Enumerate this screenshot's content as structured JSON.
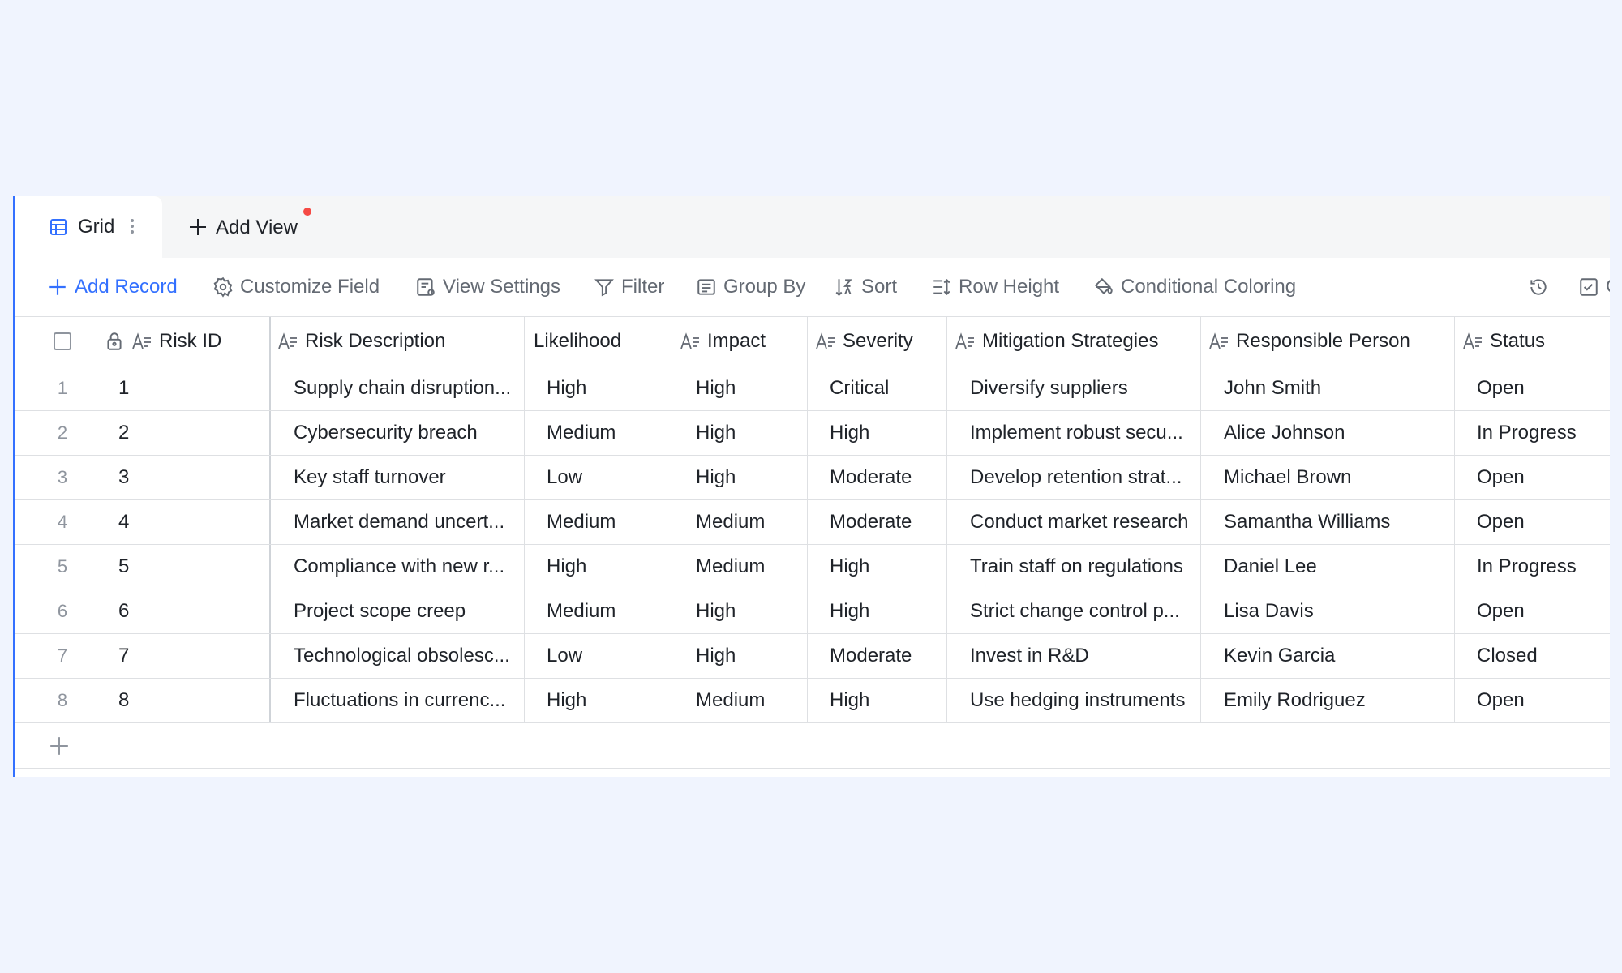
{
  "colors": {
    "accent": "#3370ff",
    "notice_dot": "#f54a45",
    "muted": "#646a73",
    "border": "#dee0e3"
  },
  "tabs": {
    "active": {
      "label": "Grid",
      "icon": "grid-table-icon"
    },
    "add_view": {
      "label": "Add View",
      "icon": "plus-icon"
    }
  },
  "toolbar": {
    "add_record": "Add Record",
    "customize_field": "Customize Field",
    "view_settings": "View Settings",
    "filter": "Filter",
    "group_by": "Group By",
    "sort": "Sort",
    "row_height": "Row Height",
    "conditional_coloring": "Conditional Coloring",
    "clipped_right": "G"
  },
  "table": {
    "headers": {
      "risk_id": "Risk ID",
      "risk_description": "Risk Description",
      "likelihood": "Likelihood",
      "impact": "Impact",
      "severity": "Severity",
      "mitigation": "Mitigation Strategies",
      "responsible": "Responsible Person",
      "status": "Status"
    },
    "rows": [
      {
        "n": "1",
        "id": "1",
        "desc": "Supply chain disruption...",
        "likelihood": "High",
        "impact": "High",
        "severity": "Critical",
        "mitigation": "Diversify suppliers",
        "person": "John Smith",
        "status": "Open"
      },
      {
        "n": "2",
        "id": "2",
        "desc": "Cybersecurity breach",
        "likelihood": "Medium",
        "impact": "High",
        "severity": "High",
        "mitigation": "Implement robust secu...",
        "person": "Alice Johnson",
        "status": "In Progress"
      },
      {
        "n": "3",
        "id": "3",
        "desc": "Key staff turnover",
        "likelihood": "Low",
        "impact": "High",
        "severity": "Moderate",
        "mitigation": "Develop retention strat...",
        "person": "Michael Brown",
        "status": "Open"
      },
      {
        "n": "4",
        "id": "4",
        "desc": "Market demand uncert...",
        "likelihood": "Medium",
        "impact": "Medium",
        "severity": "Moderate",
        "mitigation": "Conduct market research",
        "person": "Samantha Williams",
        "status": "Open"
      },
      {
        "n": "5",
        "id": "5",
        "desc": "Compliance with new r...",
        "likelihood": "High",
        "impact": "Medium",
        "severity": "High",
        "mitigation": "Train staff on regulations",
        "person": "Daniel Lee",
        "status": "In Progress"
      },
      {
        "n": "6",
        "id": "6",
        "desc": "Project scope creep",
        "likelihood": "Medium",
        "impact": "High",
        "severity": "High",
        "mitigation": "Strict change control p...",
        "person": "Lisa Davis",
        "status": "Open"
      },
      {
        "n": "7",
        "id": "7",
        "desc": "Technological obsolesc...",
        "likelihood": "Low",
        "impact": "High",
        "severity": "Moderate",
        "mitigation": "Invest in R&D",
        "person": "Kevin Garcia",
        "status": "Closed"
      },
      {
        "n": "8",
        "id": "8",
        "desc": "Fluctuations in currenc...",
        "likelihood": "High",
        "impact": "Medium",
        "severity": "High",
        "mitigation": "Use hedging instruments",
        "person": "Emily Rodriguez",
        "status": "Open"
      }
    ]
  }
}
